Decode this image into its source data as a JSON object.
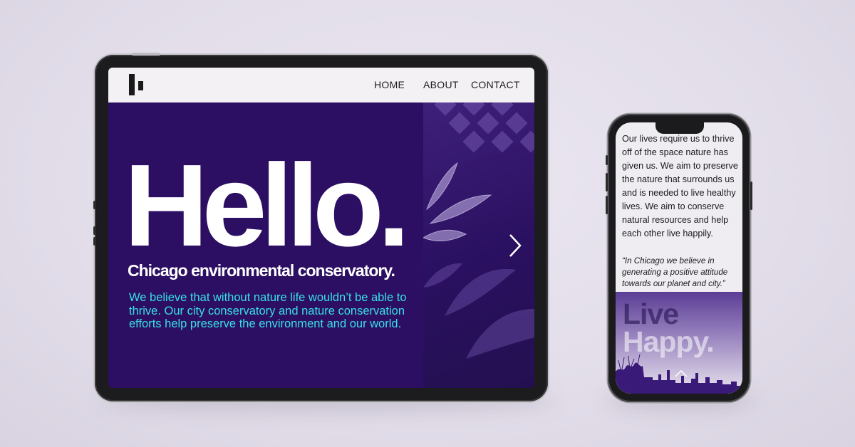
{
  "tablet": {
    "nav": {
      "logo": "logo-mark",
      "links": [
        "HOME",
        "ABOUT",
        "CONTACT"
      ]
    },
    "hero": {
      "title": "Hello.",
      "subtitle": "Chicago environmental conservatory.",
      "body": "We believe that without nature life wouldn’t be able to thrive. Our city conservatory and nature conservation efforts help preserve the environment and our world.",
      "next_icon": "chevron-right-icon"
    },
    "colors": {
      "hero_bg": "#2c0f63",
      "body_text": "#38e0e6",
      "navbar_bg": "#f3f1f4"
    }
  },
  "phone": {
    "paragraph": "Our lives require us to thrive off of the space nature has given us. We aim to preserve the nature that surrounds us and is needed to live healthy lives. We aim to conserve natural resources and help each other live happily.",
    "quote": "“In Chicago we believe in generating a positive attitude towards our planet and city.”",
    "live_line1": "Live",
    "live_line2": "Happy.",
    "scroll_icon": "chevron-up-icon"
  }
}
